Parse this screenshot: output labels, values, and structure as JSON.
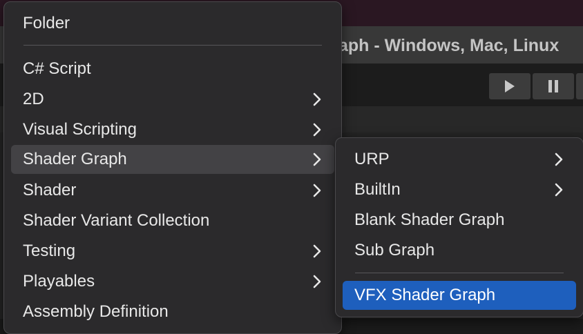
{
  "window": {
    "title": "aph - Windows, Mac, Linux"
  },
  "toolbar": {
    "play_icon": "play-icon",
    "pause_icon": "pause-icon"
  },
  "context_menu": {
    "items": [
      {
        "label": "Folder",
        "submenu": false
      },
      {
        "label": "C# Script",
        "submenu": false
      },
      {
        "label": "2D",
        "submenu": true
      },
      {
        "label": "Visual Scripting",
        "submenu": true
      },
      {
        "label": "Shader Graph",
        "submenu": true,
        "state": "highlighted"
      },
      {
        "label": "Shader",
        "submenu": true
      },
      {
        "label": "Shader Variant Collection",
        "submenu": false
      },
      {
        "label": "Testing",
        "submenu": true
      },
      {
        "label": "Playables",
        "submenu": true
      },
      {
        "label": "Assembly Definition",
        "submenu": false
      }
    ]
  },
  "submenu": {
    "items": [
      {
        "label": "URP",
        "submenu": true
      },
      {
        "label": "BuiltIn",
        "submenu": true
      },
      {
        "label": "Blank Shader Graph",
        "submenu": false
      },
      {
        "label": "Sub Graph",
        "submenu": false
      },
      {
        "label": "VFX Shader Graph",
        "submenu": false,
        "state": "selected"
      }
    ]
  },
  "colors": {
    "menu_bg": "#2b2a2c",
    "highlight": "#434245",
    "selected": "#1e5fbd",
    "text": "#e8e8e8"
  }
}
